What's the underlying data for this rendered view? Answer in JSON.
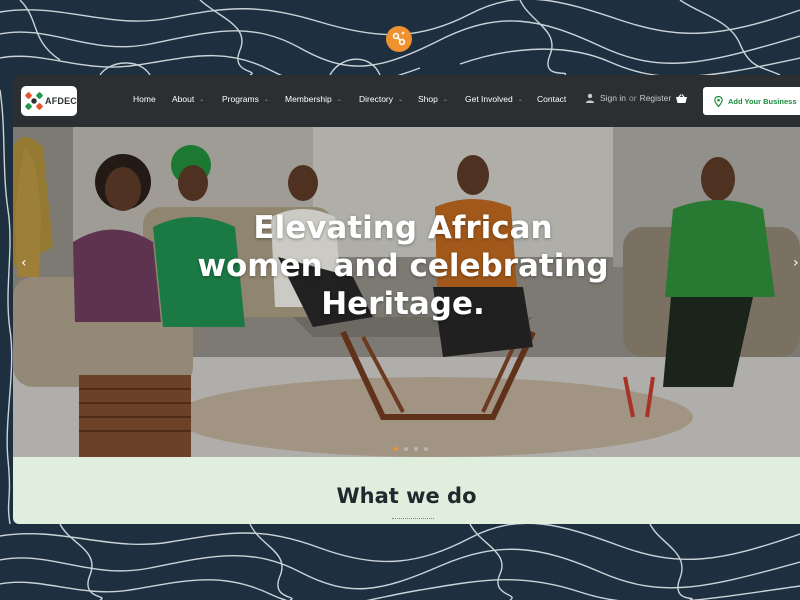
{
  "site": {
    "brand_text": "AFDEC"
  },
  "nav": {
    "items": [
      {
        "label": "Home",
        "dropdown": false
      },
      {
        "label": "About",
        "dropdown": true
      },
      {
        "label": "Programs",
        "dropdown": true
      },
      {
        "label": "Membership",
        "dropdown": true
      },
      {
        "label": "Directory",
        "dropdown": true
      },
      {
        "label": "Shop",
        "dropdown": true
      },
      {
        "label": "Get Involved",
        "dropdown": true
      },
      {
        "label": "Contact",
        "dropdown": false
      }
    ],
    "caret": "⌄",
    "signin": {
      "sign_in": "Sign in",
      "or": "or",
      "register": "Register"
    },
    "add_business_label": "Add Your Business"
  },
  "hero": {
    "title_lines": [
      "Elevating African",
      "women and celebrating",
      "Heritage."
    ],
    "prev_arrow": "‹",
    "next_arrow": "›",
    "slide_count": 4,
    "active_slide": 1
  },
  "section": {
    "title": "What we do"
  },
  "icons": [
    "logo-icon",
    "user-icon",
    "cart-icon",
    "map-pin-icon",
    "chevron-left-icon",
    "chevron-right-icon"
  ],
  "colors": {
    "background": "#1e3040",
    "navbar": "#2b2f31",
    "accent_orange": "#f0912f",
    "button_green": "#198a3b",
    "section_bg": "#dfeedd"
  }
}
